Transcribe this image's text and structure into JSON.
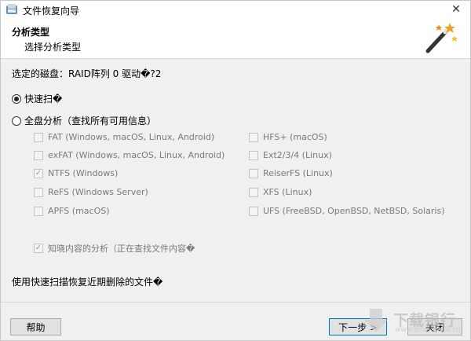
{
  "window": {
    "title": "文件恢复向导",
    "close_glyph": "✕"
  },
  "header": {
    "title": "分析类型",
    "subtitle": "选择分析类型",
    "icon": "magic-wand-icon"
  },
  "selected_disk": "选定的磁盘：RAID阵列 0 驱动�?2",
  "scan_options": {
    "quick": {
      "label": "快速扫�",
      "checked": true
    },
    "full": {
      "label": "全盘分析（查找所有可用信息）",
      "checked": false
    }
  },
  "filesystems_left": [
    {
      "label": "FAT (Windows, macOS, Linux, Android)",
      "checked": false
    },
    {
      "label": "exFAT (Windows, macOS, Linux, Android)",
      "checked": false
    },
    {
      "label": "NTFS (Windows)",
      "checked": true
    },
    {
      "label": "ReFS (Windows Server)",
      "checked": false
    },
    {
      "label": "APFS (macOS)",
      "checked": false
    }
  ],
  "filesystems_right": [
    {
      "label": "HFS+ (macOS)",
      "checked": false
    },
    {
      "label": "Ext2/3/4 (Linux)",
      "checked": false
    },
    {
      "label": "ReiserFS (Linux)",
      "checked": false
    },
    {
      "label": "XFS (Linux)",
      "checked": false
    },
    {
      "label": "UFS (FreeBSD, OpenBSD, NetBSD, Solaris)",
      "checked": false
    }
  ],
  "content_analysis": {
    "label": "知晓内容的分析（正在查找文件内容�",
    "checked": true
  },
  "footer_hint": "使用快速扫描恢复近期删除的文件�",
  "buttons": {
    "help": "帮助",
    "next": "下一步 >",
    "close": "关闭"
  },
  "watermark": {
    "text": "下载银行",
    "url": "www.downbank.cn"
  },
  "colors": {
    "accent": "#0078d7",
    "disabled_text": "#7a7a7a"
  }
}
